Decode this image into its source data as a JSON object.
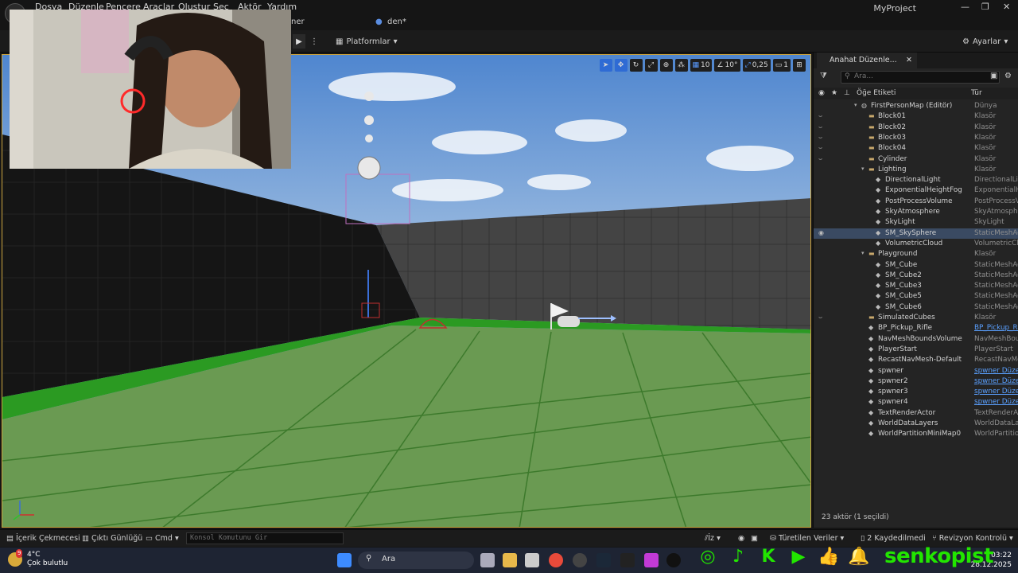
{
  "menu": [
    "Dosya",
    "Düzenle",
    "Pencere",
    "Araçlar",
    "Oluştur",
    "Seç",
    "Aktör",
    "Yardım"
  ],
  "project_name": "MyProject",
  "tabs": {
    "left_fragment": "ner",
    "level_tab": "den*"
  },
  "toolbar": {
    "platforms": "Platformlar",
    "settings": "Ayarlar"
  },
  "viewport_toolbar": {
    "grid_snap": "10",
    "rotation_snap": "10°",
    "scale_snap": "0,25",
    "camera_speed": "1"
  },
  "outliner": {
    "tab_title": "Anahat Düzenle...",
    "search_placeholder": "Ara...",
    "col_label": "Öğe Etiketi",
    "col_type": "Tür",
    "rows": [
      {
        "label": "FirstPersonMap (Editör)",
        "type": "Dünya",
        "indent": 0,
        "kind": "world",
        "eye": false,
        "arrow": "▾"
      },
      {
        "label": "Block01",
        "type": "Klasör",
        "indent": 1,
        "kind": "folder",
        "eye": true,
        "arrow": ""
      },
      {
        "label": "Block02",
        "type": "Klasör",
        "indent": 1,
        "kind": "folder",
        "eye": true,
        "arrow": ""
      },
      {
        "label": "Block03",
        "type": "Klasör",
        "indent": 1,
        "kind": "folder",
        "eye": true,
        "arrow": ""
      },
      {
        "label": "Block04",
        "type": "Klasör",
        "indent": 1,
        "kind": "folder",
        "eye": true,
        "arrow": ""
      },
      {
        "label": "Cylinder",
        "type": "Klasör",
        "indent": 1,
        "kind": "folder",
        "eye": true,
        "arrow": ""
      },
      {
        "label": "Lighting",
        "type": "Klasör",
        "indent": 1,
        "kind": "folder",
        "eye": false,
        "arrow": "▾"
      },
      {
        "label": "DirectionalLight",
        "type": "DirectionalLig",
        "indent": 2,
        "kind": "obj",
        "eye": false,
        "arrow": ""
      },
      {
        "label": "ExponentialHeightFog",
        "type": "ExponentialHe",
        "indent": 2,
        "kind": "obj",
        "eye": false,
        "arrow": ""
      },
      {
        "label": "PostProcessVolume",
        "type": "PostProcessV",
        "indent": 2,
        "kind": "obj",
        "eye": false,
        "arrow": ""
      },
      {
        "label": "SkyAtmosphere",
        "type": "SkyAtmosphe",
        "indent": 2,
        "kind": "obj",
        "eye": false,
        "arrow": ""
      },
      {
        "label": "SkyLight",
        "type": "SkyLight",
        "indent": 2,
        "kind": "obj",
        "eye": false,
        "arrow": ""
      },
      {
        "label": "SM_SkySphere",
        "type": "StaticMeshAc",
        "indent": 2,
        "kind": "obj",
        "eye": true,
        "arrow": "",
        "selected": true
      },
      {
        "label": "VolumetricCloud",
        "type": "VolumetricClo",
        "indent": 2,
        "kind": "obj",
        "eye": false,
        "arrow": ""
      },
      {
        "label": "Playground",
        "type": "Klasör",
        "indent": 1,
        "kind": "folder",
        "eye": false,
        "arrow": "▾"
      },
      {
        "label": "SM_Cube",
        "type": "StaticMeshAc",
        "indent": 2,
        "kind": "obj",
        "eye": false,
        "arrow": ""
      },
      {
        "label": "SM_Cube2",
        "type": "StaticMeshAc",
        "indent": 2,
        "kind": "obj",
        "eye": false,
        "arrow": ""
      },
      {
        "label": "SM_Cube3",
        "type": "StaticMeshAc",
        "indent": 2,
        "kind": "obj",
        "eye": false,
        "arrow": ""
      },
      {
        "label": "SM_Cube5",
        "type": "StaticMeshAc",
        "indent": 2,
        "kind": "obj",
        "eye": false,
        "arrow": ""
      },
      {
        "label": "SM_Cube6",
        "type": "StaticMeshAc",
        "indent": 2,
        "kind": "obj",
        "eye": false,
        "arrow": ""
      },
      {
        "label": "SimulatedCubes",
        "type": "Klasör",
        "indent": 1,
        "kind": "folder",
        "eye": true,
        "arrow": ""
      },
      {
        "label": "BP_Pickup_Rifle",
        "type": "BP_Pickup_Ri",
        "indent": 1,
        "kind": "obj",
        "eye": false,
        "arrow": "",
        "link": true
      },
      {
        "label": "NavMeshBoundsVolume",
        "type": "NavMeshBour",
        "indent": 1,
        "kind": "obj",
        "eye": false,
        "arrow": ""
      },
      {
        "label": "PlayerStart",
        "type": "PlayerStart",
        "indent": 1,
        "kind": "obj",
        "eye": false,
        "arrow": ""
      },
      {
        "label": "RecastNavMesh-Default",
        "type": "RecastNavMe",
        "indent": 1,
        "kind": "obj",
        "eye": false,
        "arrow": ""
      },
      {
        "label": "spwner",
        "type": "spwner Düzer",
        "indent": 1,
        "kind": "obj",
        "eye": false,
        "arrow": "",
        "link": true
      },
      {
        "label": "spwner2",
        "type": "spwner Düzer",
        "indent": 1,
        "kind": "obj",
        "eye": false,
        "arrow": "",
        "link": true
      },
      {
        "label": "spwner3",
        "type": "spwner Düzer",
        "indent": 1,
        "kind": "obj",
        "eye": false,
        "arrow": "",
        "link": true
      },
      {
        "label": "spwner4",
        "type": "spwner Düzer",
        "indent": 1,
        "kind": "obj",
        "eye": false,
        "arrow": "",
        "link": true
      },
      {
        "label": "TextRenderActor",
        "type": "TextRenderAct",
        "indent": 1,
        "kind": "obj",
        "eye": false,
        "arrow": ""
      },
      {
        "label": "WorldDataLayers",
        "type": "WorldDataLay",
        "indent": 1,
        "kind": "obj",
        "eye": false,
        "arrow": ""
      },
      {
        "label": "WorldPartitionMiniMap0",
        "type": "WorldPartition",
        "indent": 1,
        "kind": "obj",
        "eye": false,
        "arrow": ""
      }
    ],
    "footer": "23 aktör (1 seçildi)"
  },
  "statusbar": {
    "content_drawer": "İçerik Çekmecesi",
    "output_log": "Çıktı Günlüğü",
    "cmd": "Cmd",
    "console_placeholder": "Konsol Komutunu Gir",
    "trace": "İz",
    "derived_data": "Türetilen Veriler",
    "saved": "2 Kaydedilmedi",
    "revision": "Revizyon Kontrolü"
  },
  "taskbar": {
    "weather_temp": "4°C",
    "weather_desc": "Çok bulutlu",
    "weather_badge": "9",
    "search": "Ara",
    "brand": "senkopist",
    "time": "03:22",
    "date": "28.12.2025"
  },
  "colors": {
    "accent": "#2f6bd4",
    "brand_green": "#22e600",
    "viewport_border": "#c8a13c",
    "selected_row": "#3a4a62"
  }
}
